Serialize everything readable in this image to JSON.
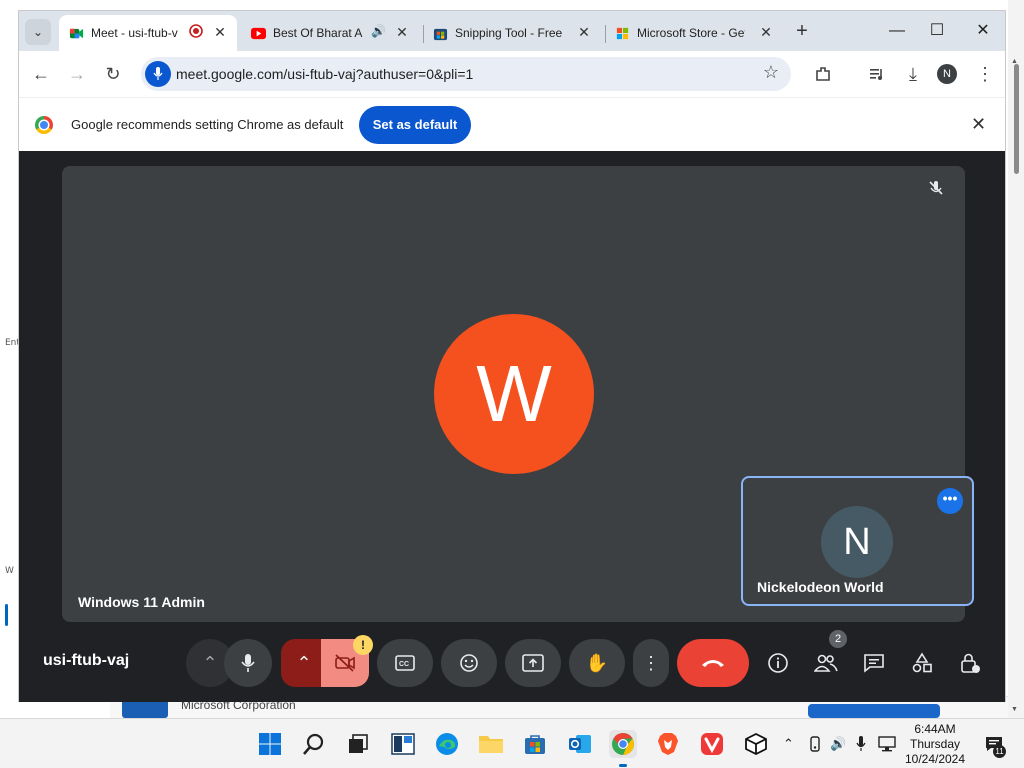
{
  "background": {
    "left_texts": [
      "Ent",
      "W"
    ],
    "behind_window_text": "Microsoft Corporation"
  },
  "browser": {
    "tabs": [
      {
        "title": "Meet - usi-ftub-v",
        "active": true,
        "icon": "google-meet-icon",
        "extra": "recording-icon"
      },
      {
        "title": "Best Of Bharat A",
        "active": false,
        "icon": "youtube-icon",
        "extra": "speaker-icon"
      },
      {
        "title": "Snipping Tool - Free",
        "active": false,
        "icon": "microsoft-store-icon"
      },
      {
        "title": "Microsoft Store - Get",
        "active": false,
        "icon": "microsoft-store-icon"
      }
    ],
    "url": "meet.google.com/usi-ftub-vaj?authuser=0&pli=1",
    "profile_initial": "N",
    "infobar": {
      "message": "Google recommends setting Chrome as default",
      "button": "Set as default"
    }
  },
  "meet": {
    "main_avatar_letter": "W",
    "main_name": "Windows 11 Admin",
    "tile_avatar_letter": "N",
    "tile_name": "Nickelodeon World",
    "meeting_code": "usi-ftub-vaj",
    "participants_count": "2",
    "warning_mark": "!",
    "colors": {
      "main_avatar": "#f4511e",
      "end_call": "#ea4335",
      "tile_border": "#8ab4f8"
    }
  },
  "taskbar": {
    "time": "6:44AM",
    "day": "Thursday",
    "date": "10/24/2024",
    "notification_count": "11"
  }
}
